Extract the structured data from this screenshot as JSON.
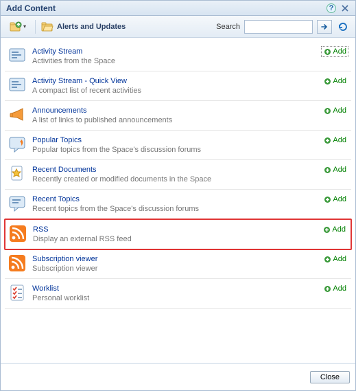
{
  "header": {
    "title": "Add Content"
  },
  "toolbar": {
    "breadcrumb_label": "Alerts and Updates",
    "search_label": "Search",
    "search_value": ""
  },
  "items": [
    {
      "title": "Activity Stream",
      "desc": "Activities from the Space",
      "action": "Add",
      "icon": "activity-stream-icon",
      "highlight": false,
      "boxed": true
    },
    {
      "title": "Activity Stream - Quick View",
      "desc": "A compact list of recent activities",
      "action": "Add",
      "icon": "activity-stream-icon",
      "highlight": false,
      "boxed": false
    },
    {
      "title": "Announcements",
      "desc": "A list of links to published announcements",
      "action": "Add",
      "icon": "announcement-icon",
      "highlight": false,
      "boxed": false
    },
    {
      "title": "Popular Topics",
      "desc": "Popular topics from the Space's discussion forums",
      "action": "Add",
      "icon": "popular-topics-icon",
      "highlight": false,
      "boxed": false
    },
    {
      "title": "Recent Documents",
      "desc": "Recently created or modified documents in the Space",
      "action": "Add",
      "icon": "document-star-icon",
      "highlight": false,
      "boxed": false
    },
    {
      "title": "Recent Topics",
      "desc": "Recent topics from the Space's discussion forums",
      "action": "Add",
      "icon": "recent-topics-icon",
      "highlight": false,
      "boxed": false
    },
    {
      "title": "RSS",
      "desc": "Display an external RSS feed",
      "action": "Add",
      "icon": "rss-icon",
      "highlight": true,
      "boxed": false
    },
    {
      "title": "Subscription viewer",
      "desc": "Subscription viewer",
      "action": "Add",
      "icon": "rss-icon",
      "highlight": false,
      "boxed": false
    },
    {
      "title": "Worklist",
      "desc": "Personal worklist",
      "action": "Add",
      "icon": "worklist-icon",
      "highlight": false,
      "boxed": false
    }
  ],
  "footer": {
    "close_label": "Close"
  }
}
